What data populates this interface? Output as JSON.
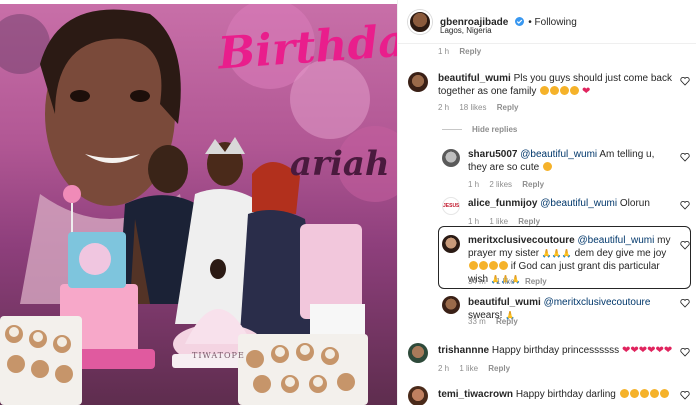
{
  "post": {
    "username": "gbenroajibade",
    "verified": true,
    "follow_label": "Following",
    "location": "Lagos, Nigeria",
    "top_meta_time": "1 h",
    "top_meta_reply": "Reply"
  },
  "photo": {
    "banner_text": "Birthda",
    "name_text": "ariah",
    "topper_text": "TIWATOPE"
  },
  "comments": [
    {
      "username": "beautiful_wumi",
      "text": "Pls you guys should just come back together as one family",
      "time": "2 h",
      "likes": "18 likes",
      "reply": "Reply"
    },
    {
      "hide_replies": "Hide replies"
    },
    {
      "username": "sharu5007",
      "mention": "@beautiful_wumi",
      "text": "Am telling u, they are so cute",
      "time": "1 h",
      "likes": "2 likes",
      "reply": "Reply"
    },
    {
      "username": "alice_funmijoy",
      "mention": "@beautiful_wumi",
      "text": "Olorun",
      "time": "1 h",
      "likes": "1 like",
      "reply": "Reply"
    },
    {
      "username": "meritxclusivecoutoure",
      "mention": "@beautiful_wumi",
      "text_a": "my prayer my sister",
      "text_b": "dem dey give me joy",
      "text_c": "if God can just grant dis particular wish",
      "time": "34 m",
      "likes": "1 like",
      "reply": "Reply"
    },
    {
      "username": "beautiful_wumi",
      "mention": "@meritxclusivecoutoure",
      "text": "swears!",
      "time": "33 m",
      "reply": "Reply"
    },
    {
      "username": "trishannne",
      "text": "Happy birthday princessssss",
      "time": "2 h",
      "likes": "1 like",
      "reply": "Reply"
    },
    {
      "username": "temi_tiwacrown",
      "text": "Happy birthday darling"
    }
  ],
  "icons": {
    "verified": "verified-badge-icon",
    "like": "heart-outline-icon"
  },
  "colors": {
    "mention": "#00376b",
    "meta": "#8e8e8e",
    "verified": "#3897f0",
    "photo_pink": "#e91e8c"
  }
}
